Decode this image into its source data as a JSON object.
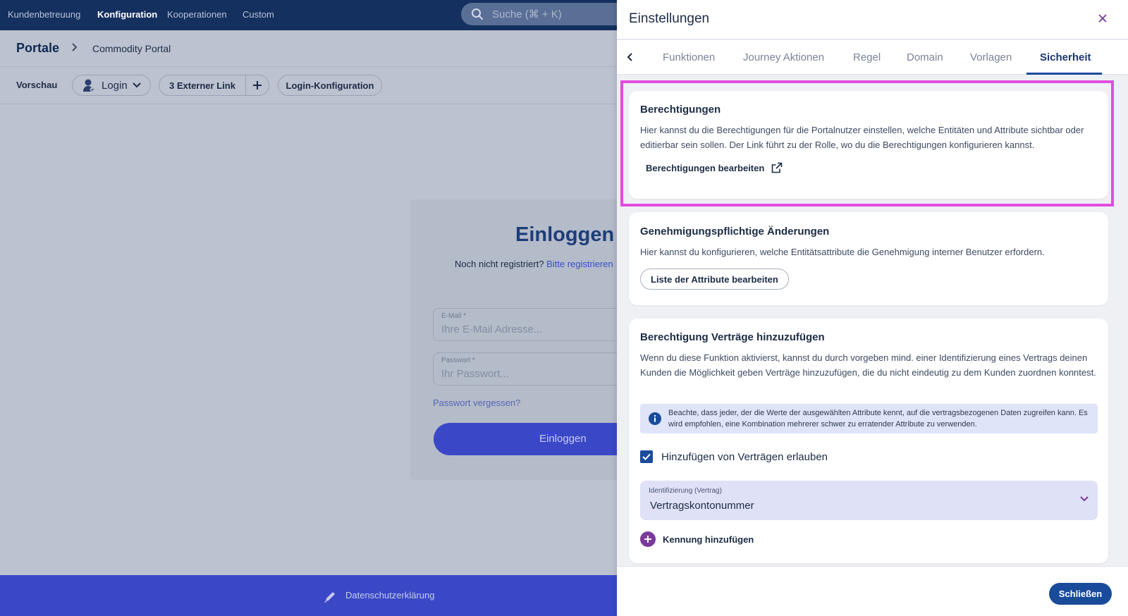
{
  "topnav": {
    "items": [
      {
        "label": "Kundenbetreuung",
        "active": false
      },
      {
        "label": "Konfiguration",
        "active": true
      },
      {
        "label": "Kooperationen",
        "active": false
      },
      {
        "label": "Custom",
        "active": false
      }
    ],
    "search_placeholder": "Suche (⌘ + K)"
  },
  "breadcrumb": {
    "root": "Portale",
    "current": "Commodity Portal"
  },
  "toolbar": {
    "preview_label": "Vorschau",
    "login_select": "Login",
    "external_link": "3 Externer Link",
    "login_config": "Login-Konfiguration"
  },
  "login": {
    "title": "Einloggen",
    "not_registered": "Noch nicht registriert?",
    "register_link": "Bitte registrieren",
    "email_label": "E-Mail *",
    "email_placeholder": "Ihre E-Mail Adresse...",
    "password_label": "Passwort *",
    "password_placeholder": "Ihr Passwort...",
    "forgot": "Passwort vergessen?",
    "button": "Einloggen"
  },
  "footer": {
    "privacy": "Datenschutzerklärung"
  },
  "panel": {
    "title": "Einstellungen",
    "tabs": [
      "Funktionen",
      "Journey Aktionen",
      "Regel",
      "Domain",
      "Vorlagen",
      "Sicherheit"
    ],
    "active_tab": "Sicherheit",
    "permissions": {
      "title": "Berechtigungen",
      "description": "Hier kannst du die Berechtigungen für die Portalnutzer einstellen, welche Entitäten und Attribute sichtbar oder editierbar sein sollen. Der Link führt zu der Rolle, wo du die Berechtigungen konfigurieren kannst.",
      "edit_link": "Berechtigungen bearbeiten"
    },
    "approval": {
      "title": "Genehmigungspflichtige Änderungen",
      "description": "Hier kannst du konfigurieren, welche Entitätsattribute die Genehmigung interner Benutzer erfordern.",
      "button": "Liste der Attribute bearbeiten"
    },
    "contracts": {
      "title": "Berechtigung Verträge hinzuzufügen",
      "description": "Wenn du diese Funktion aktivierst, kannst du durch vorgeben mind. einer Identifizierung eines Vertrags deinen Kunden die Möglichkeit geben Verträge hinzuzufügen, die du nicht eindeutig zu dem Kunden zuordnen konntest.",
      "info": "Beachte, dass jeder, der die Werte der ausgewählten Attribute kennt, auf die vertragsbezogenen Daten zugreifen kann. Es wird empfohlen, eine Kombination mehrerer schwer zu erratender Attribute zu verwenden.",
      "checkbox_label": "Hinzufügen von Verträgen erlauben",
      "checkbox_checked": true,
      "select_label": "Identifizierung (Vertrag)",
      "select_value": "Vertragskontonummer",
      "add_identifier": "Kennung hinzufügen"
    },
    "close_button": "Schließen"
  },
  "colors": {
    "nav_bg": "#14305f",
    "primary": "#1a4b9b",
    "highlight": "#e34ce0",
    "login_button": "#3a48c7"
  }
}
